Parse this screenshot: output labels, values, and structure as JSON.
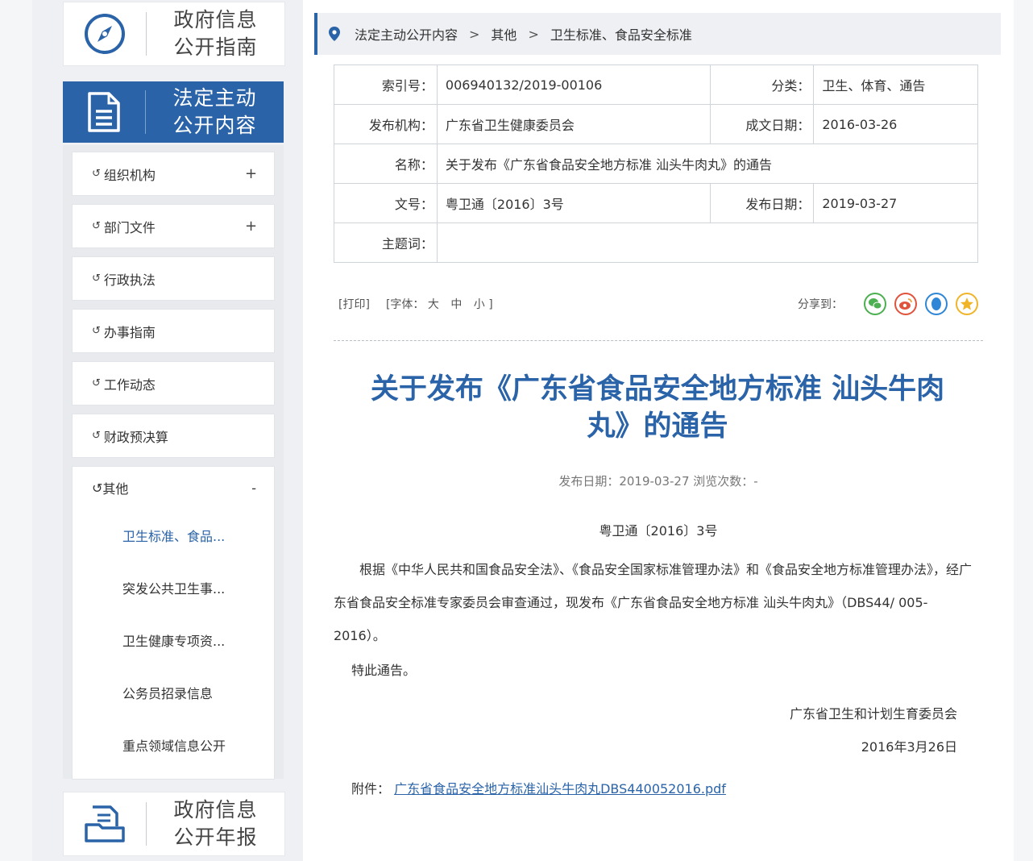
{
  "sidebar": {
    "top_card": {
      "line1": "政府信息",
      "line2": "公开指南"
    },
    "active_card": {
      "line1": "法定主动",
      "line2": "公开内容"
    },
    "nav_items": [
      {
        "label": "组织机构",
        "toggle": "+"
      },
      {
        "label": "部门文件",
        "toggle": "+"
      },
      {
        "label": "行政执法",
        "toggle": ""
      },
      {
        "label": "办事指南",
        "toggle": ""
      },
      {
        "label": "工作动态",
        "toggle": ""
      },
      {
        "label": "财政预决算",
        "toggle": ""
      }
    ],
    "expanded": {
      "label": "其他",
      "toggle": "-",
      "sub_items": [
        "卫生标准、食品...",
        "突发公共卫生事...",
        "卫生健康专项资...",
        "公务员招录信息",
        "重点领域信息公开"
      ]
    },
    "bottom_card": {
      "line1": "政府信息",
      "line2": "公开年报"
    },
    "leaf_glyph": "↺"
  },
  "breadcrumb": {
    "items": [
      "法定主动公开内容",
      "其他",
      "卫生标准、食品安全标准"
    ],
    "separator": ">"
  },
  "info": {
    "index_label": "索引号：",
    "index_value": "006940132/2019-00106",
    "category_label": "分类：",
    "category_value": "卫生、体育、通告",
    "publisher_label": "发布机构：",
    "publisher_value": "广东省卫生健康委员会",
    "written_label": "成文日期：",
    "written_value": "2016-03-26",
    "name_label": "名称：",
    "name_value": "关于发布《广东省食品安全地方标准 汕头牛肉丸》的通告",
    "docno_label": "文号：",
    "docno_value": "粤卫通〔2016〕3号",
    "pubdate_label": "发布日期：",
    "pubdate_value": "2019-03-27",
    "subject_label": "主题词：",
    "subject_value": ""
  },
  "toolbar": {
    "print": "[打印]",
    "font_prefix": "[字体：",
    "font_large": "大",
    "font_medium": "中",
    "font_small": "小",
    "font_suffix": "]",
    "share_label": "分享到："
  },
  "share_colors": {
    "wechat": "#4caf50",
    "weibo": "#e0533c",
    "qq": "#2f86d6",
    "qzone": "#f0b429"
  },
  "article": {
    "title": "关于发布《广东省食品安全地方标准 汕头牛肉丸》的通告",
    "meta": "发布日期：2019-03-27  浏览次数：-",
    "doc_number": "粤卫通〔2016〕3号",
    "body": "根据《中华人民共和国食品安全法》、《食品安全国家标准管理办法》和《食品安全地方标准管理办法》，经广东省食品安全标准专家委员会审查通过，现发布《广东省食品安全地方标准 汕头牛肉丸》（DBS44/ 005-2016）。",
    "closing": "特此通告。",
    "signer": "广东省卫生和计划生育委员会",
    "sign_date": "2016年3月26日",
    "attachment_label": "附件：",
    "attachment_link": "广东省食品安全地方标准汕头牛肉丸DBS440052016.pdf"
  }
}
